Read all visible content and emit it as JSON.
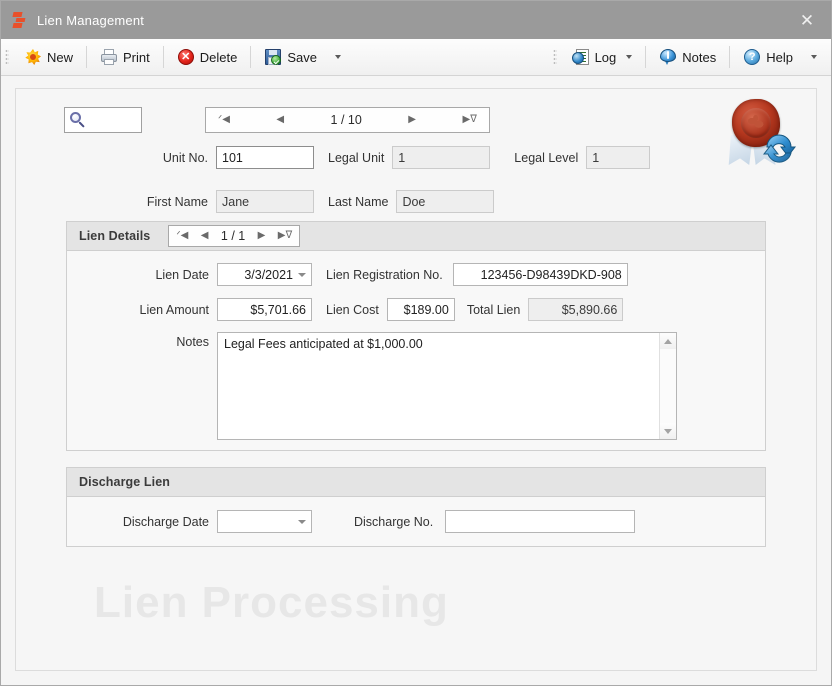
{
  "window": {
    "title": "Lien Management",
    "app_icon": "app-logo-icon",
    "close_label": "✕"
  },
  "toolbar": {
    "left_items": [
      {
        "label": "New",
        "icon": "new-icon",
        "dropdown": false
      },
      {
        "label": "Print",
        "icon": "print-icon",
        "dropdown": false
      },
      {
        "label": "Delete",
        "icon": "delete-icon",
        "dropdown": false
      },
      {
        "label": "Save",
        "icon": "save-icon",
        "dropdown": true
      }
    ],
    "right_items": [
      {
        "label": "Log",
        "icon": "log-icon",
        "dropdown": true
      },
      {
        "label": "Notes",
        "icon": "notes-icon",
        "dropdown": false
      },
      {
        "label": "Help",
        "icon": "help-icon",
        "dropdown": true
      }
    ]
  },
  "search": {
    "icon": "search-icon",
    "value": "",
    "placeholder": ""
  },
  "record_nav": {
    "first": "ᐟ◀",
    "prev": "◀",
    "position": "1 / 10",
    "next": "▶",
    "last": "▶ᐁ"
  },
  "seal": {
    "icon": "wax-seal-refresh-icon"
  },
  "header_fields": [
    {
      "label": "Unit No.",
      "value": "101",
      "readonly": false
    },
    {
      "label": "Legal Unit",
      "value": "1",
      "readonly": true
    },
    {
      "label": "Legal Level",
      "value": "1",
      "readonly": true
    },
    {
      "label": "First Name",
      "value": "Jane",
      "readonly": true
    },
    {
      "label": "Last Name",
      "value": "Doe",
      "readonly": true
    }
  ],
  "lien_details": {
    "title": "Lien Details",
    "nav": {
      "first": "ᐟ◀",
      "prev": "◀",
      "position": "1 / 1",
      "next": "▶",
      "last": "▶ᐁ"
    },
    "lien_date": {
      "label": "Lien Date",
      "value": "3/3/2021"
    },
    "lien_registration_no": {
      "label": "Lien Registration No.",
      "value": "123456-D98439DKD-908"
    },
    "lien_amount": {
      "label": "Lien Amount",
      "value": "$5,701.66"
    },
    "lien_cost": {
      "label": "Lien Cost",
      "value": "$189.00"
    },
    "total_lien": {
      "label": "Total Lien",
      "value": "$5,890.66"
    },
    "notes": {
      "label": "Notes",
      "value": "Legal Fees anticipated at $1,000.00"
    }
  },
  "discharge_lien": {
    "title": "Discharge Lien",
    "discharge_date": {
      "label": "Discharge Date",
      "value": ""
    },
    "discharge_no": {
      "label": "Discharge No.",
      "value": ""
    }
  },
  "watermark": {
    "text": "Lien Processing"
  },
  "colors": {
    "titlebar": "#9a9a9a",
    "accent_orange": "#e8502a",
    "panel_bg": "#f6f6f6",
    "group_header": "#e4e4e4",
    "watermark": "#e7e7e7"
  }
}
